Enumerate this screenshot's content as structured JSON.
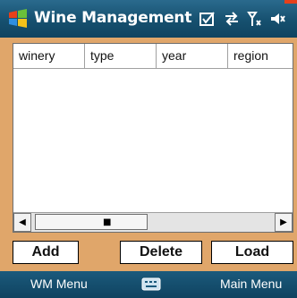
{
  "title_bar": {
    "title": "Wine Management",
    "icons": [
      "windows-start-icon",
      "inbox-check-icon",
      "sync-arrows-icon",
      "signal-antenna-icon",
      "speaker-icon"
    ]
  },
  "grid": {
    "columns": [
      "winery",
      "type",
      "year",
      "region"
    ],
    "rows": []
  },
  "buttons": {
    "add": "Add",
    "delete": "Delete",
    "load": "Load"
  },
  "softkeys": {
    "left": "WM Menu",
    "center_icon": "keyboard-icon",
    "right": "Main Menu"
  },
  "colors": {
    "titlebar": "#16506f",
    "background": "#e0a66a",
    "softbar": "#0f4360"
  }
}
